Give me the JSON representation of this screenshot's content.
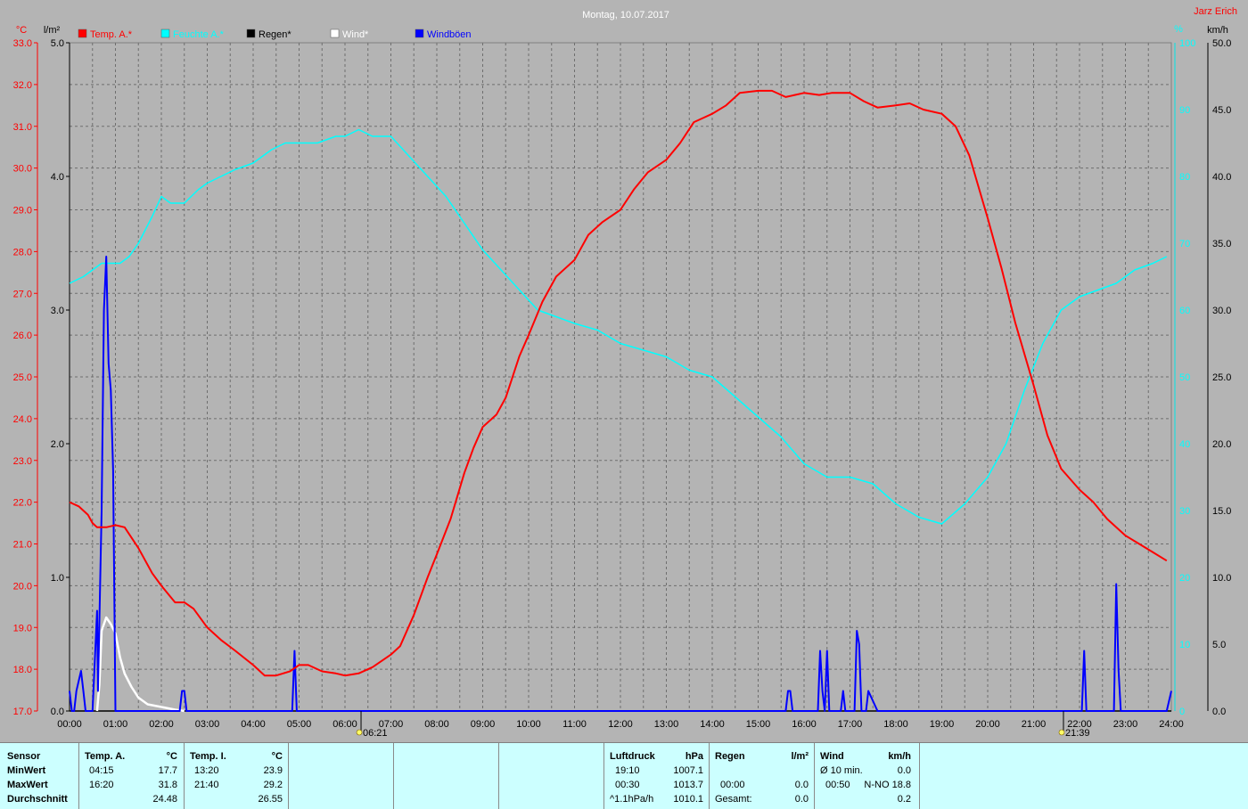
{
  "header": {
    "title": "Montag, 10.07.2017",
    "author": "Jarz Erich",
    "unit_left_temp": "°C",
    "unit_left_rain": "l/m²",
    "unit_right_pct": "%",
    "unit_right_wind": "km/h"
  },
  "legend": [
    {
      "label": "Temp. A.*",
      "color": "#ff0000"
    },
    {
      "label": "Feuchte A.*",
      "color": "#00ffff"
    },
    {
      "label": "Regen*",
      "color": "#000000"
    },
    {
      "label": "Wind*",
      "color": "#ffffff"
    },
    {
      "label": "Windböen",
      "color": "#0000ff"
    }
  ],
  "chart_data": {
    "type": "line",
    "title": "Montag, 10.07.2017",
    "x_ticks": [
      "00:00",
      "01:00",
      "02:00",
      "03:00",
      "04:00",
      "05:00",
      "06:00",
      "07:00",
      "08:00",
      "09:00",
      "10:00",
      "11:00",
      "12:00",
      "13:00",
      "14:00",
      "15:00",
      "16:00",
      "17:00",
      "18:00",
      "19:00",
      "20:00",
      "21:00",
      "22:00",
      "23:00",
      "24:00"
    ],
    "x_range_hours": [
      0,
      24
    ],
    "axes": {
      "temp_c": {
        "range": [
          17.0,
          33.0
        ],
        "ticks": [
          "17.0",
          "18.0",
          "19.0",
          "20.0",
          "21.0",
          "22.0",
          "23.0",
          "24.0",
          "25.0",
          "26.0",
          "27.0",
          "28.0",
          "29.0",
          "30.0",
          "31.0",
          "32.0",
          "33.0"
        ],
        "color": "#ff0000"
      },
      "rain_lm2": {
        "range": [
          0.0,
          5.0
        ],
        "ticks": [
          "0.0",
          "1.0",
          "2.0",
          "3.0",
          "4.0",
          "5.0"
        ],
        "color": "#000000"
      },
      "humidity_pct": {
        "range": [
          0,
          100
        ],
        "ticks": [
          "0",
          "10",
          "20",
          "30",
          "40",
          "50",
          "60",
          "70",
          "80",
          "90",
          "100"
        ],
        "color": "#00ffff"
      },
      "wind_kmh": {
        "range": [
          0.0,
          50.0
        ],
        "ticks": [
          "0.0",
          "5.0",
          "10.0",
          "15.0",
          "20.0",
          "25.0",
          "30.0",
          "35.0",
          "40.0",
          "45.0",
          "50.0"
        ],
        "color": "#000000"
      }
    },
    "grid": true,
    "legend_position": "top",
    "sunrise": "06:21",
    "sunset": "21:39",
    "series": [
      {
        "name": "Temp. A.*",
        "axis": "temp_c",
        "color": "#ff0000",
        "x": [
          0,
          0.2,
          0.4,
          0.5,
          0.6,
          0.7,
          0.8,
          1.0,
          1.2,
          1.5,
          1.8,
          2.0,
          2.3,
          2.5,
          2.7,
          3.0,
          3.3,
          3.6,
          4.0,
          4.25,
          4.5,
          4.8,
          5.0,
          5.2,
          5.5,
          5.8,
          6.0,
          6.3,
          6.6,
          7.0,
          7.2,
          7.5,
          7.8,
          8.0,
          8.3,
          8.6,
          8.8,
          9.0,
          9.3,
          9.5,
          9.8,
          10.0,
          10.3,
          10.6,
          11.0,
          11.3,
          11.6,
          12.0,
          12.3,
          12.6,
          13.0,
          13.3,
          13.6,
          14.0,
          14.3,
          14.6,
          15.0,
          15.3,
          15.6,
          16.0,
          16.33,
          16.6,
          17.0,
          17.3,
          17.6,
          18.0,
          18.3,
          18.6,
          19.0,
          19.3,
          19.6,
          20.0,
          20.3,
          20.6,
          21.0,
          21.3,
          21.6,
          22.0,
          22.3,
          22.6,
          23.0,
          23.3,
          23.6,
          23.9
        ],
        "y": [
          22.0,
          21.9,
          21.7,
          21.5,
          21.4,
          21.4,
          21.4,
          21.45,
          21.4,
          20.9,
          20.3,
          20.0,
          19.6,
          19.6,
          19.45,
          19.0,
          18.7,
          18.45,
          18.1,
          17.85,
          17.85,
          17.95,
          18.1,
          18.1,
          17.95,
          17.9,
          17.85,
          17.9,
          18.05,
          18.35,
          18.55,
          19.3,
          20.2,
          20.75,
          21.6,
          22.7,
          23.3,
          23.8,
          24.1,
          24.5,
          25.5,
          26.0,
          26.8,
          27.4,
          27.8,
          28.4,
          28.7,
          29.0,
          29.5,
          29.9,
          30.2,
          30.6,
          31.1,
          31.3,
          31.5,
          31.8,
          31.85,
          31.85,
          31.7,
          31.8,
          31.75,
          31.8,
          31.8,
          31.6,
          31.45,
          31.5,
          31.55,
          31.4,
          31.3,
          31.0,
          30.3,
          28.8,
          27.6,
          26.3,
          24.8,
          23.6,
          22.8,
          22.3,
          22.0,
          21.6,
          21.2,
          21.0,
          20.8,
          20.6
        ]
      },
      {
        "name": "Feuchte A.*",
        "axis": "humidity_pct",
        "color": "#00ffff",
        "x": [
          0,
          0.3,
          0.5,
          0.7,
          0.9,
          1.1,
          1.3,
          1.5,
          1.8,
          2.0,
          2.2,
          2.5,
          2.8,
          3.0,
          3.3,
          3.6,
          4.0,
          4.4,
          4.7,
          5.0,
          5.4,
          5.8,
          6.0,
          6.3,
          6.6,
          7.0,
          7.4,
          7.8,
          8.2,
          8.6,
          9.0,
          9.4,
          9.8,
          10.2,
          10.6,
          11.0,
          11.5,
          12.0,
          12.5,
          13.0,
          13.5,
          14.0,
          14.5,
          15.0,
          15.5,
          16.0,
          16.5,
          17.0,
          17.5,
          18.0,
          18.5,
          19.0,
          19.5,
          20.0,
          20.4,
          20.8,
          21.2,
          21.6,
          22.0,
          22.4,
          22.8,
          23.2,
          23.6,
          23.9
        ],
        "y": [
          64,
          65,
          66,
          67,
          67,
          67,
          68,
          70,
          74,
          77,
          76,
          76,
          78,
          79,
          80,
          81,
          82,
          84,
          85,
          85,
          85,
          86,
          86,
          87,
          86,
          86,
          83,
          80,
          77,
          73,
          69,
          66,
          63,
          60,
          59,
          58,
          57,
          55,
          54,
          53,
          51,
          50,
          47,
          44,
          41,
          37,
          35,
          35,
          34,
          31,
          29,
          28,
          31,
          35,
          40,
          48,
          55,
          60,
          62,
          63,
          64,
          66,
          67,
          68
        ]
      },
      {
        "name": "Windböen",
        "axis": "wind_kmh",
        "color": "#0000ff",
        "x": [
          0,
          0.05,
          0.1,
          0.15,
          0.25,
          0.3,
          0.35,
          0.4,
          0.45,
          0.5,
          0.6,
          0.62,
          0.7,
          0.75,
          0.8,
          0.85,
          0.9,
          0.95,
          1.0,
          1.05,
          1.1,
          1.15,
          1.2,
          1.25,
          1.3,
          1.35,
          2.4,
          2.45,
          2.5,
          2.55,
          2.6,
          4.85,
          4.9,
          4.95,
          5.0,
          15.6,
          15.65,
          15.7,
          15.75,
          16.3,
          16.35,
          16.4,
          16.45,
          16.5,
          16.55,
          16.6,
          16.65,
          16.75,
          16.8,
          16.85,
          16.9,
          16.95,
          17.0,
          17.1,
          17.15,
          17.2,
          17.25,
          17.3,
          17.35,
          17.4,
          17.6,
          17.65,
          17.7,
          17.75,
          22.05,
          22.1,
          22.15,
          22.2,
          22.25,
          22.3,
          22.75,
          22.8,
          22.85,
          22.9,
          22.95,
          23.0,
          23.9,
          24.0
        ],
        "y": [
          1.5,
          0,
          0,
          1.5,
          3.0,
          1.5,
          0,
          0,
          0,
          0,
          7.5,
          1.5,
          15,
          30,
          34,
          26,
          24,
          18,
          0,
          0,
          0,
          0,
          0,
          0,
          0,
          0,
          0,
          1.5,
          1.5,
          0,
          0,
          0,
          4.5,
          0,
          0,
          0,
          1.5,
          1.5,
          0,
          0,
          4.5,
          1.5,
          0,
          4.5,
          0,
          0,
          0,
          0,
          0,
          1.5,
          0,
          0,
          0,
          0,
          6.0,
          5.0,
          0,
          0,
          0,
          1.5,
          0,
          0,
          0,
          0,
          0,
          4.5,
          0,
          0,
          0,
          0,
          0,
          9.5,
          3.0,
          0,
          0,
          0,
          0,
          1.5
        ]
      },
      {
        "name": "Wind*",
        "axis": "wind_kmh",
        "color": "#ffffff",
        "x": [
          0.6,
          0.65,
          0.7,
          0.8,
          0.9,
          1.0,
          1.1,
          1.2,
          1.35,
          1.5,
          1.7,
          2.0,
          2.3,
          2.5
        ],
        "y": [
          0,
          2,
          6,
          7,
          6.5,
          5.8,
          4,
          2.8,
          1.8,
          1.0,
          0.5,
          0.3,
          0.1,
          0
        ]
      },
      {
        "name": "Regen*",
        "axis": "rain_lm2",
        "color": "#000000",
        "x": [
          0,
          24
        ],
        "y": [
          0,
          0
        ]
      }
    ]
  },
  "table": {
    "sensor_col": {
      "header": "Sensor",
      "rows": [
        "MinWert",
        "MaxWert",
        "Durchschnitt"
      ]
    },
    "temp_a": {
      "header": "Temp. A.",
      "unit": "°C",
      "rows": [
        {
          "time": "04:15",
          "value": "17.7"
        },
        {
          "time": "16:20",
          "value": "31.8"
        },
        {
          "time": "",
          "value": "24.48"
        }
      ]
    },
    "temp_i": {
      "header": "Temp. I.",
      "unit": "°C",
      "rows": [
        {
          "time": "13:20",
          "value": "23.9"
        },
        {
          "time": "21:40",
          "value": "29.2"
        },
        {
          "time": "",
          "value": "26.55"
        }
      ]
    },
    "pressure": {
      "header": "Luftdruck",
      "unit": "hPa",
      "rows": [
        {
          "time": "19:10",
          "value": "1007.1"
        },
        {
          "time": "00:30",
          "value": "1013.7"
        },
        {
          "time": "^1.1hPa/h",
          "value": "1010.1"
        }
      ]
    },
    "rain": {
      "header": "Regen",
      "unit": "l/m²",
      "rows": [
        {
          "time": "",
          "value": ""
        },
        {
          "time": "00:00",
          "value": "0.0"
        },
        {
          "time": "Gesamt:",
          "value": "0.0"
        }
      ]
    },
    "wind": {
      "header": "Wind",
      "unit": "km/h",
      "rows": [
        {
          "time": "Ø 10 min.",
          "value": "0.0"
        },
        {
          "time": "00:50",
          "value": "N-NO 18.8"
        },
        {
          "time": "",
          "value": "0.2"
        }
      ]
    }
  }
}
